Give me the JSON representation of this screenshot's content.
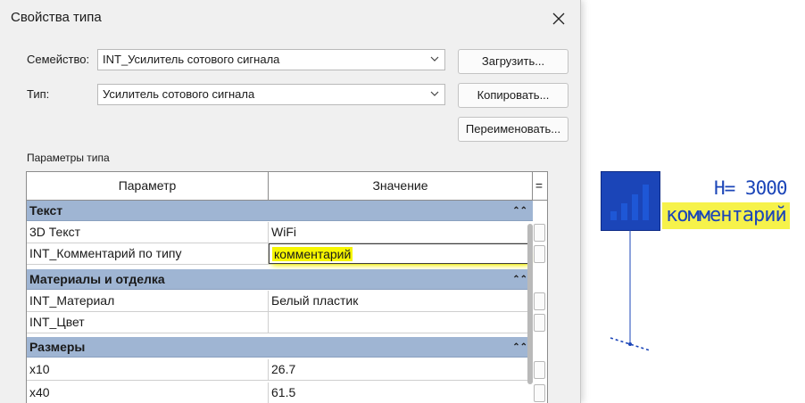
{
  "dialog": {
    "title": "Свойства типа",
    "family_label": "Семейство:",
    "family_value": "INT_Усилитель сотового сигнала",
    "type_label": "Тип:",
    "type_value": "Усилитель сотового сигнала",
    "load_button": "Загрузить...",
    "copy_button": "Копировать...",
    "rename_button": "Переименовать...",
    "params_label": "Параметры типа"
  },
  "grid": {
    "col_param": "Параметр",
    "col_value": "Значение",
    "col_eq": "=",
    "groups": [
      {
        "name": "Текст",
        "rows": [
          {
            "param": "3D Текст",
            "value": "WiFi"
          },
          {
            "param": "INT_Комментарий по типу",
            "value": "комментарий"
          }
        ]
      },
      {
        "name": "Материалы и отделка",
        "rows": [
          {
            "param": "INT_Материал",
            "value": "Белый пластик"
          },
          {
            "param": "INT_Цвет",
            "value": ""
          }
        ]
      },
      {
        "name": "Размеры",
        "rows": [
          {
            "param": "x10",
            "value": "26.7"
          },
          {
            "param": "x40",
            "value": "61.5"
          }
        ]
      }
    ],
    "collapse_glyph": "⌃⌃"
  },
  "tag": {
    "height_text": "H= 3000",
    "comment_text": "комментарий"
  },
  "colors": {
    "group_header": "#9fb5d3",
    "highlight": "#f6f600",
    "tag_blue": "#1b45b8"
  }
}
